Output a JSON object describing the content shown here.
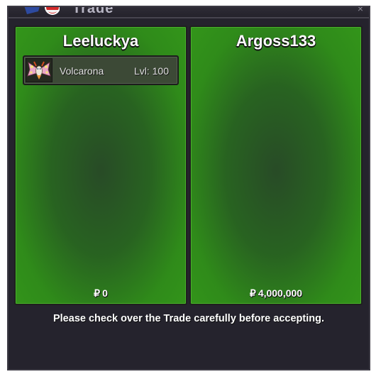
{
  "window": {
    "title": "Trade",
    "close_glyph": "×",
    "colors": {
      "background": "#25232d",
      "panel_green": "#33951a",
      "text": "#ffffff"
    }
  },
  "left_panel": {
    "player_name": "Leeluckya",
    "offered_pokemon": [
      {
        "name": "Volcarona",
        "level": "Lvl: 100",
        "icon": "volcarona-sprite-icon"
      }
    ],
    "currency_symbol": "₽",
    "money": "0"
  },
  "right_panel": {
    "player_name": "Argoss133",
    "offered_pokemon": [],
    "currency_symbol": "₽",
    "money": "4,000,000"
  },
  "notice": "Please check over the Trade carefully before accepting."
}
